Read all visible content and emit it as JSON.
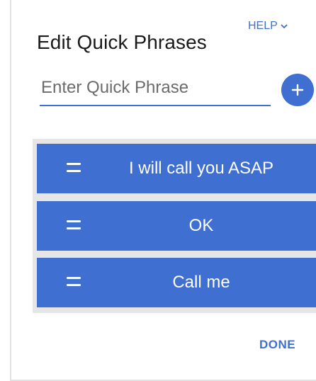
{
  "dialog": {
    "title": "Edit Quick Phrases",
    "help_label": "HELP",
    "done_label": "DONE"
  },
  "input": {
    "placeholder": "Enter Quick Phrase",
    "value": ""
  },
  "icons": {
    "add": "plus-icon",
    "help_dropdown": "chevron-down-icon",
    "drag": "drag-handle-icon"
  },
  "phrases": [
    {
      "label": "I will call you ASAP"
    },
    {
      "label": "OK"
    },
    {
      "label": "Call me"
    }
  ],
  "colors": {
    "accent": "#3f6fd0",
    "list_background": "#e6e6e6",
    "text": "#1a1a1a"
  }
}
